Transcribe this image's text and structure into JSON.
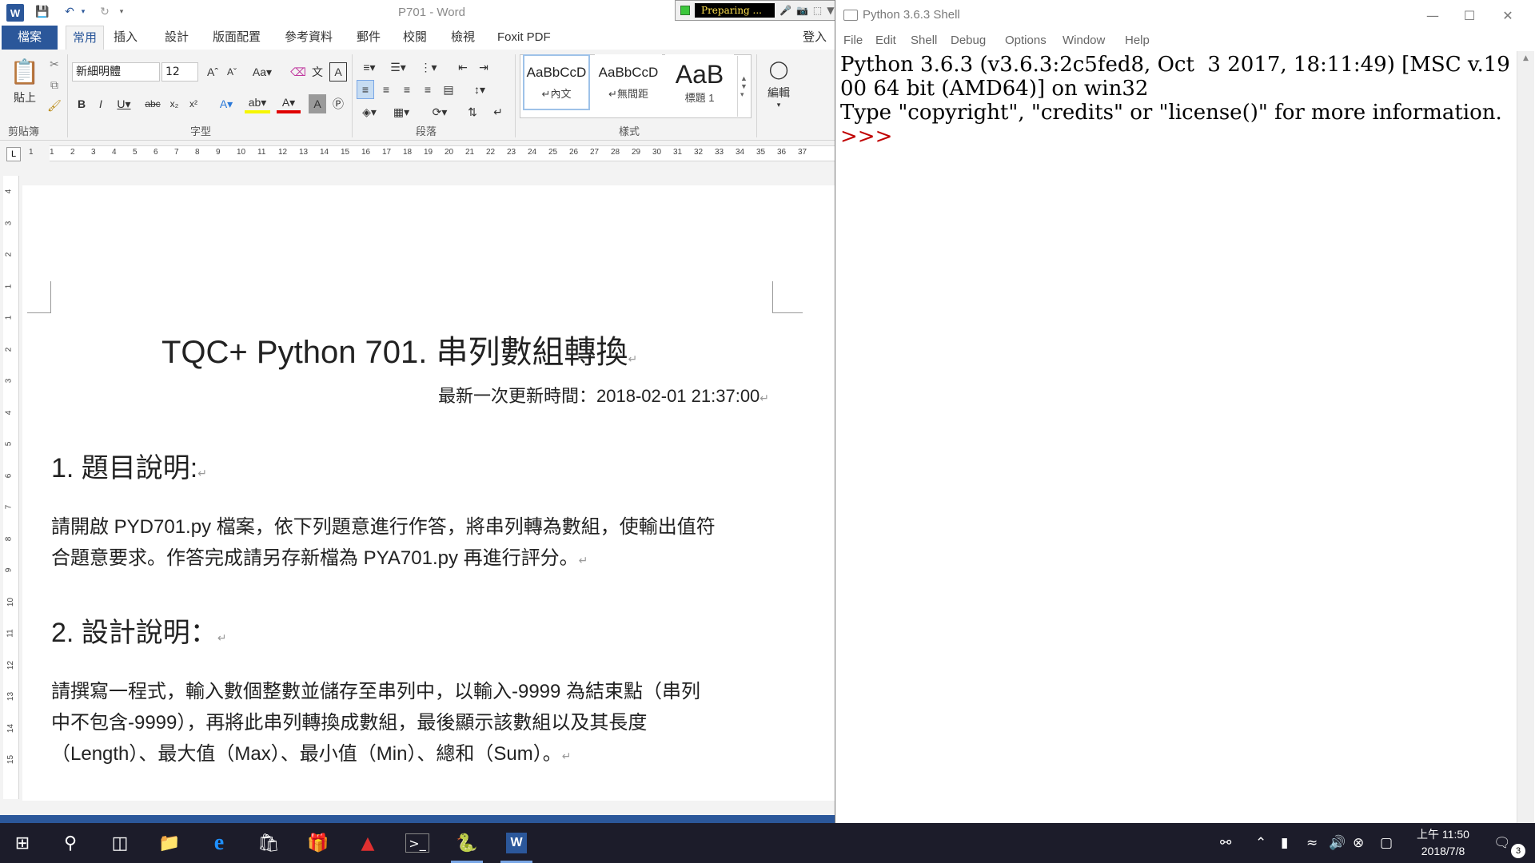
{
  "word": {
    "window_title": "P701 - Word",
    "recording_status": "Preparing ...",
    "tabs": [
      "檔案",
      "常用",
      "插入",
      "設計",
      "版面配置",
      "參考資料",
      "郵件",
      "校閱",
      "檢視",
      "Foxit PDF"
    ],
    "login": "登入",
    "clipboard": {
      "paste_label": "貼上",
      "group_label": "剪貼簿"
    },
    "font": {
      "name": "新細明體",
      "size": "12",
      "group_label": "字型"
    },
    "paragraph": {
      "group_label": "段落"
    },
    "styles": {
      "group_label": "樣式",
      "items": [
        {
          "sample": "AaBbCcD",
          "name": "↵內文"
        },
        {
          "sample": "AaBbCcD",
          "name": "↵無間距"
        },
        {
          "sample": "AaB",
          "name": "標題 1"
        }
      ]
    },
    "editing": {
      "label": "編輯"
    },
    "ruler_numbers": [
      "1",
      "1",
      "2",
      "3",
      "4",
      "5",
      "6",
      "7",
      "8",
      "9",
      "10",
      "11",
      "12",
      "13",
      "14",
      "15",
      "16",
      "17",
      "18",
      "19",
      "20",
      "21",
      "22",
      "23",
      "24",
      "25",
      "26",
      "27",
      "28",
      "29",
      "30",
      "31",
      "32",
      "33",
      "34",
      "35",
      "36",
      "37"
    ],
    "vruler_numbers": [
      "4",
      "3",
      "2",
      "1",
      "1",
      "2",
      "3",
      "4",
      "5",
      "6",
      "7",
      "8",
      "9",
      "10",
      "11",
      "12",
      "13",
      "14",
      "15"
    ],
    "document": {
      "title": "TQC+ Python 701.  串列數組轉換",
      "updated": "最新一次更新時間：2018-02-01 21:37:00",
      "heading1": "1.  題目說明:",
      "para1_line1": "請開啟 PYD701.py 檔案，依下列題意進行作答，將串列轉為數組，使輸出值符",
      "para1_line2": "合題意要求。作答完成請另存新檔為 PYA701.py 再進行評分。",
      "heading2": "2.  設計說明：",
      "para2_line1": "請撰寫一程式，輸入數個整數並儲存至串列中，以輸入-9999 為結束點（串列",
      "para2_line2": "中不包含-9999），再將此串列轉換成數組，最後顯示該數組以及其長度",
      "para2_line3": "（Length）、最大值（Max）、最小值（Min）、總和（Sum）。"
    }
  },
  "python_shell": {
    "window_title": "Python 3.6.3 Shell",
    "menu": [
      "File",
      "Edit",
      "Shell",
      "Debug",
      "Options",
      "Window",
      "Help"
    ],
    "banner": "Python 3.6.3 (v3.6.3:2c5fed8, Oct  3 2017, 18:11:49) [MSC v.1900 64 bit (AMD64)] on win32\nType \"copyright\", \"credits\" or \"license()\" for more information.",
    "prompt": ">>>"
  },
  "taskbar": {
    "time": "上午 11:50",
    "date": "2018/7/8",
    "notification_count": "3"
  },
  "colors": {
    "word_blue": "#2b579a",
    "prompt_red": "#c00000",
    "taskbar_bg": "#1c1c2a"
  }
}
